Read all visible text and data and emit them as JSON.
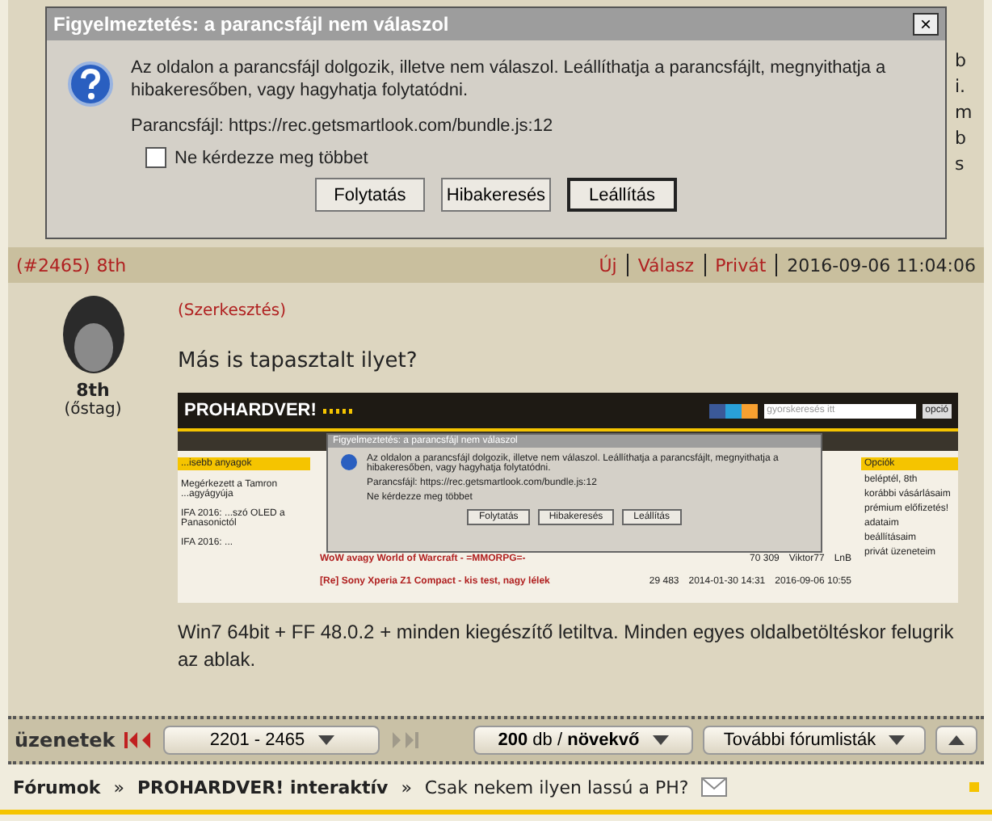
{
  "behind_text": [
    "b",
    "i.",
    "m",
    "b",
    "s"
  ],
  "dialog": {
    "title": "Figyelmeztetés: a parancsfájl nem válaszol",
    "close": "×",
    "message": "Az oldalon a parancsfájl dolgozik, illetve nem válaszol. Leállíthatja a parancsfájlt, megnyithatja a hibakeresőben, vagy hagyhatja folytatódni.",
    "script": "Parancsfájl: https://rec.getsmartlook.com/bundle.js:12",
    "checkbox": {
      "label": "Ne kérdezze meg többet",
      "checked": false
    },
    "buttons": [
      {
        "label": "Folytatás",
        "default": false
      },
      {
        "label": "Hibakeresés",
        "default": false
      },
      {
        "label": "Leállítás",
        "default": true
      }
    ]
  },
  "post": {
    "number": "(#2465)",
    "author_link": "8th",
    "actions": [
      "Új",
      "Válasz",
      "Privát"
    ],
    "date": "2016-09-06 11:04:06",
    "author": "8th",
    "rank": "(őstag)",
    "edited": "(Szerkesztés)",
    "question": "Más is tapasztalt ilyet?",
    "body": "Win7 64bit + FF 48.0.2 + minden kiegészítő letiltva. Minden egyes oldalbetöltéskor felugrik az ablak.",
    "screenshot": {
      "logo": "PROHARDVER!",
      "search_placeholder": "gyorskeresés itt",
      "search_button": "opció",
      "left_title": "...isebb anyagok",
      "left_items": [
        "Megérkezett a Tamron ...agyágyúja",
        "IFA 2016: ...szó OLED a Panasonictól",
        "IFA 2016: ..."
      ],
      "rows": [
        {
          "title": "WoW avagy World of Warcraft - =MMORPG=-",
          "count": "70 309",
          "user": "Viktor77",
          "last": "LnB"
        },
        {
          "title": "[Re] Sony Xperia Z1 Compact - kis test, nagy lélek",
          "count": "29 483",
          "user": "2014-01-30 14:31",
          "last": "2016-09-06 10:55"
        }
      ],
      "right_title": "Opciók",
      "right_items": [
        "beléptél, 8th",
        "korábbi vásárlásaim",
        "prémium előfizetés!",
        "adataim",
        "beállításaim",
        "privát üzeneteim"
      ],
      "dialog": {
        "title": "Figyelmeztetés: a parancsfájl nem válaszol",
        "message": "Az oldalon a parancsfájl dolgozik, illetve nem válaszol. Leállíthatja a parancsfájlt, megnyithatja a hibakeresőben, vagy hagyhatja folytatódni.",
        "script": "Parancsfájl: https://rec.getsmartlook.com/bundle.js:12",
        "checkbox": "Ne kérdezze meg többet",
        "buttons": [
          "Folytatás",
          "Hibakeresés",
          "Leállítás"
        ]
      }
    }
  },
  "nav": {
    "label": "üzenetek",
    "range": "2201 - 2465",
    "per_page": "**200** db / **növekvő**",
    "more": "További fórumlisták"
  },
  "breadcrumb": [
    "Fórumok",
    "PROHARDVER! interaktív",
    "Csak nekem ilyen lassú a PH?"
  ],
  "separator": "»"
}
